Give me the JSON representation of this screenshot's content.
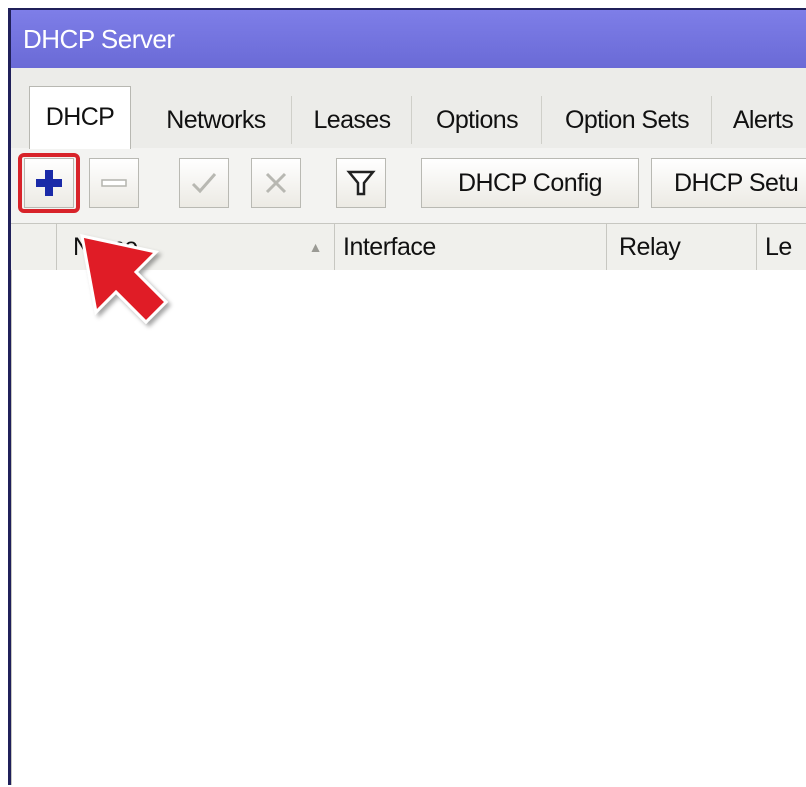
{
  "window": {
    "title": "DHCP Server"
  },
  "tabs": [
    {
      "label": "DHCP",
      "active": true
    },
    {
      "label": "Networks",
      "active": false
    },
    {
      "label": "Leases",
      "active": false
    },
    {
      "label": "Options",
      "active": false
    },
    {
      "label": "Option Sets",
      "active": false
    },
    {
      "label": "Alerts",
      "active": false
    }
  ],
  "toolbar": {
    "add_icon": "plus-icon",
    "remove_icon": "minus-icon",
    "enable_icon": "check-icon",
    "disable_icon": "cross-icon",
    "filter_icon": "filter-icon",
    "dhcp_config_label": "DHCP Config",
    "dhcp_setup_label": "DHCP Setu"
  },
  "columns": {
    "name": "Name",
    "interface": "Interface",
    "relay": "Relay",
    "lease": "Le"
  },
  "colors": {
    "titlebar": "#6a6ad6",
    "highlight": "#d8232a",
    "add_icon": "#1a2aa8"
  }
}
